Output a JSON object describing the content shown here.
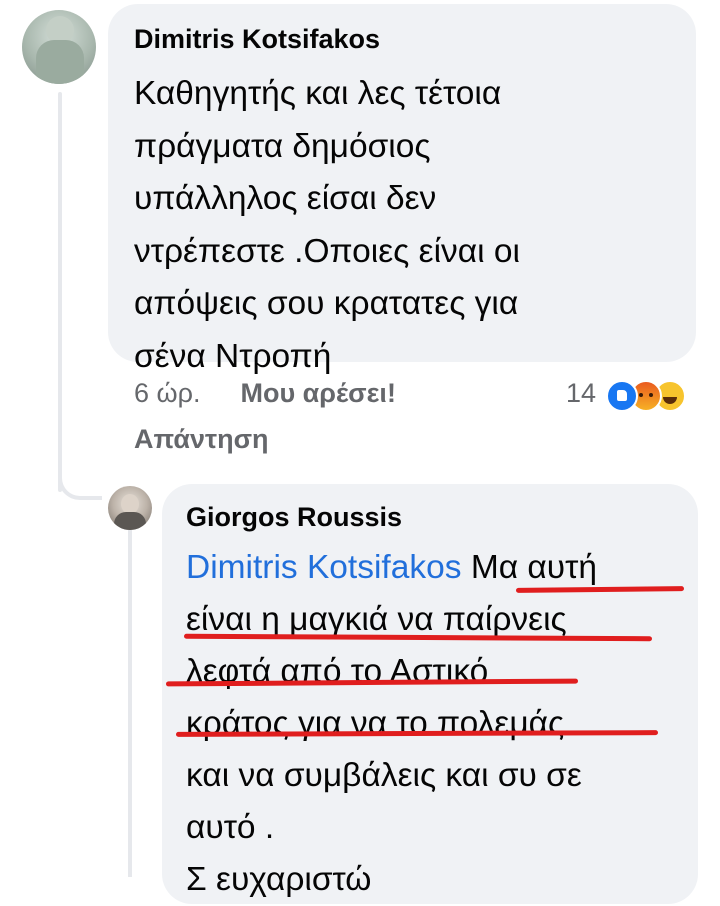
{
  "comment": {
    "author": "Dimitris Kotsifakos",
    "lines": [
      "Καθηγητής και λες τέτοια",
      "πράγματα δημόσιος",
      "υπάλληλος είσαι δεν",
      "ντρέπεστε .Οποιες είναι οι",
      "απόψεις σου κρατατες για",
      "σένα Ντροπή"
    ],
    "time": "6 ώρ.",
    "like_label": "Μου αρέσει!",
    "reply_label": "Απάντηση",
    "reaction_count": "14",
    "reactions": [
      "like-icon",
      "angry-icon",
      "haha-icon"
    ]
  },
  "reply": {
    "author": "Giorgos Roussis",
    "mention": "Dimitris Kotsifakos",
    "first_line_rest": "Μα αυτή",
    "lines": [
      "είναι η μαγκιά  να παίρνεις",
      "λεφτά από το Αστικό",
      "κράτος για να το πολεμάς",
      "και να  συμβάλεις και συ σε",
      "αυτό .",
      "Σ ευχαριστώ"
    ]
  },
  "colors": {
    "bubble": "#f0f2f5",
    "mention": "#216fdb",
    "meta": "#65676b",
    "annotation": "#e01e1e",
    "like_reaction": "#1877f2"
  }
}
